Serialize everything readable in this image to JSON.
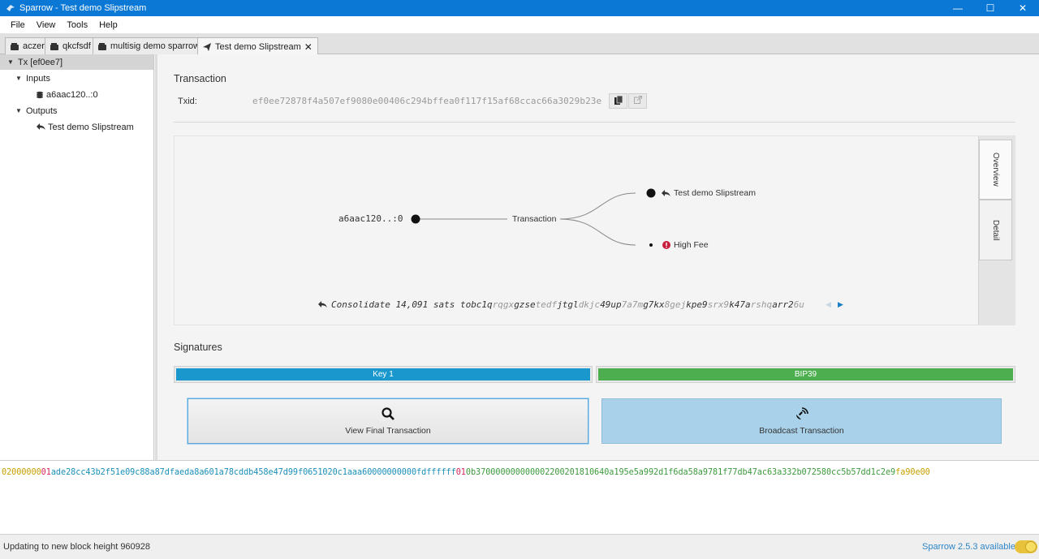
{
  "window": {
    "title": "Sparrow - Test demo Slipstream",
    "minimize": "—",
    "maximize": "☐",
    "close": "✕"
  },
  "menu": [
    "File",
    "View",
    "Tools",
    "Help"
  ],
  "tabs": [
    {
      "label": "aczer",
      "icon": "wallet-icon"
    },
    {
      "label": "qkcfsdf",
      "icon": "wallet-icon"
    },
    {
      "label": "multisig demo sparrow",
      "icon": "wallet-icon"
    },
    {
      "label": "Test demo Slipstream",
      "icon": "send-icon",
      "active": true,
      "close": "✕"
    }
  ],
  "tree": {
    "root": "Tx [ef0ee7]",
    "inputs_label": "Inputs",
    "input_item": "a6aac120..:0",
    "outputs_label": "Outputs",
    "output_item": "Test demo Slipstream"
  },
  "transaction": {
    "section_title": "Transaction",
    "txid_label": "Txid:",
    "txid": "ef0ee72878f4a507ef9080e00406c294bffea0f117f15af68ccac66a3029b23e"
  },
  "diagram": {
    "input_label": "a6aac120..:0",
    "center_label": "Transaction",
    "output_label": "Test demo Slipstream",
    "fee_label": "High Fee",
    "summary_prefix": "Consolidate 14,091 sats to ",
    "address_parts": [
      "bc1q",
      "rqgx",
      "gzse",
      "tedf",
      "jtgl",
      "dkjc",
      "49up",
      "7a7m",
      "g7kx",
      "8gej",
      "kpe9",
      "srx9",
      "k47a",
      "rshq",
      "arr2",
      "6u"
    ],
    "side_tabs": [
      "Overview",
      "Detail"
    ]
  },
  "signatures": {
    "section_title": "Signatures",
    "keys": [
      {
        "label": "Key 1",
        "color": "#1a97cc"
      },
      {
        "label": "BIP39",
        "color": "#4cae4f"
      }
    ]
  },
  "buttons": {
    "view_final": "View Final Transaction",
    "broadcast": "Broadcast Transaction"
  },
  "hex": [
    {
      "text": "02000000",
      "color": "#c8a000"
    },
    {
      "text": "01",
      "color": "#d3245b"
    },
    {
      "text": "ade28cc43b2f51e09c88a87dfaeda8a601a78cddb458e47d99f0651020c1aaa6",
      "color": "#1a8fb8"
    },
    {
      "text": "0000000000fdffffff",
      "color": "#1a8fb8"
    },
    {
      "text": "01",
      "color": "#d3245b"
    },
    {
      "text": "0b37000000000000",
      "color": "#3d9a3d"
    },
    {
      "text": "22002018",
      "color": "#3d9a3d"
    },
    {
      "text": "10640a195e5a992d1f6da58a9781f77db47ac63a332b072580cc5b57dd1c2e9",
      "color": "#3d9a3d"
    },
    {
      "text": "fa90e00",
      "color": "#c8a000"
    }
  ],
  "status": {
    "message": "Updating to new block height 960928",
    "update": "Sparrow 2.5.3 available"
  }
}
